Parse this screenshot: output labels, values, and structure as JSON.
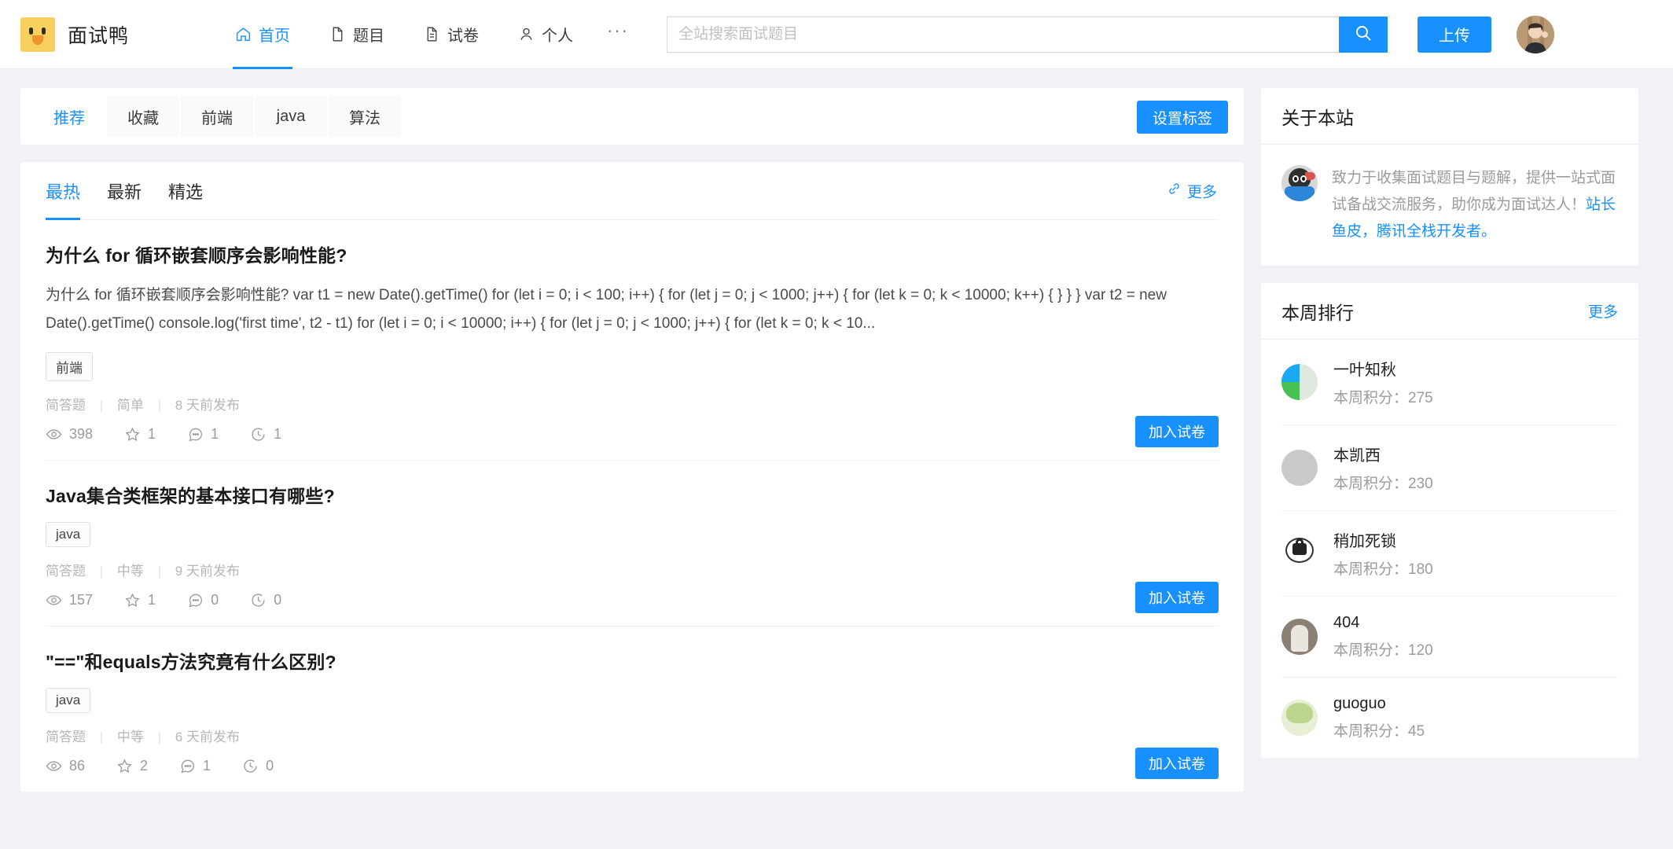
{
  "header": {
    "brand_title": "面试鸭",
    "nav": [
      {
        "label": "首页",
        "icon": "home-icon",
        "active": true
      },
      {
        "label": "题目",
        "icon": "file-icon",
        "active": false
      },
      {
        "label": "试卷",
        "icon": "paper-icon",
        "active": false
      },
      {
        "label": "个人",
        "icon": "user-icon",
        "active": false
      }
    ],
    "nav_more": "···",
    "search_placeholder": "全站搜索面试题目",
    "search_value": "",
    "search_icon": "search-icon",
    "upload_label": "上传",
    "avatar": "user-avatar"
  },
  "tagbar": {
    "chips": [
      {
        "label": "推荐",
        "active": true
      },
      {
        "label": "收藏",
        "active": false
      },
      {
        "label": "前端",
        "active": false
      },
      {
        "label": "java",
        "active": false
      },
      {
        "label": "算法",
        "active": false
      }
    ],
    "settings_label": "设置标签"
  },
  "list": {
    "tabs": [
      {
        "label": "最热",
        "active": true
      },
      {
        "label": "最新",
        "active": false
      },
      {
        "label": "精选",
        "active": false
      }
    ],
    "more_label": "更多",
    "more_icon": "link-icon",
    "join_label": "加入试卷",
    "items": [
      {
        "title": "为什么 for 循环嵌套顺序会影响性能?",
        "desc": "为什么 for 循环嵌套顺序会影响性能?  var t1 = new Date().getTime() for (let i = 0; i < 100; i++) { for (let j = 0; j < 1000; j++) { for (let k = 0; k < 10000; k++) { } } } var t2 = new Date().getTime() console.log('first time', t2 - t1) for (let i = 0; i < 10000; i++) { for (let j = 0; j < 1000; j++) { for (let k = 0; k < 10...",
        "tags": [
          "前端"
        ],
        "type": "简答题",
        "difficulty": "简单",
        "published": "8 天前发布",
        "views": "398",
        "stars": "1",
        "comments": "1",
        "history": "1"
      },
      {
        "title": "Java集合类框架的基本接口有哪些?",
        "desc": "",
        "tags": [
          "java"
        ],
        "type": "简答题",
        "difficulty": "中等",
        "published": "9 天前发布",
        "views": "157",
        "stars": "1",
        "comments": "0",
        "history": "0"
      },
      {
        "title": "\"==\"和equals方法究竟有什么区别?",
        "desc": "",
        "tags": [
          "java"
        ],
        "type": "简答题",
        "difficulty": "中等",
        "published": "6 天前发布",
        "views": "86",
        "stars": "2",
        "comments": "1",
        "history": "0"
      }
    ]
  },
  "about": {
    "title": "关于本站",
    "text_before": "致力于收集面试题目与题解，提供一站式面试备战交流服务，助你成为面试达人！",
    "link1": "站长鱼皮，",
    "link2": "腾讯全栈开发者。"
  },
  "ranking": {
    "title": "本周排行",
    "more_label": "更多",
    "score_prefix": "本周积分：",
    "items": [
      {
        "name": "一叶知秋",
        "score": "275",
        "avatar_class": "av-1"
      },
      {
        "name": "本凯西",
        "score": "230",
        "avatar_class": "av-2"
      },
      {
        "name": "稍加死锁",
        "score": "180",
        "avatar_class": "av-3"
      },
      {
        "name": "404",
        "score": "120",
        "avatar_class": "av-4"
      },
      {
        "name": "guoguo",
        "score": "45",
        "avatar_class": "av-5"
      }
    ]
  },
  "colors": {
    "accent": "#1890ff",
    "page_bg": "#f0f2f5",
    "muted": "#9b9b9b"
  }
}
